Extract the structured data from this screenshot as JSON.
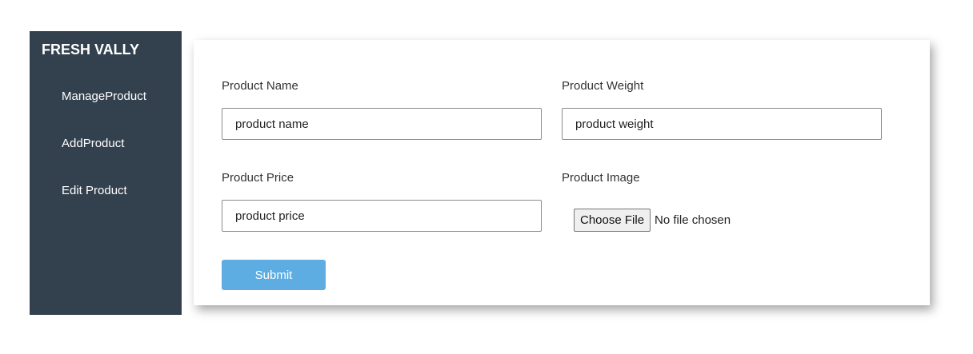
{
  "sidebar": {
    "brand": "FRESH VALLY",
    "items": [
      {
        "label": "ManageProduct"
      },
      {
        "label": "AddProduct"
      },
      {
        "label": "Edit Product"
      }
    ]
  },
  "form": {
    "name": {
      "label": "Product Name",
      "placeholder": "product name"
    },
    "weight": {
      "label": "Product Weight",
      "placeholder": "product weight"
    },
    "price": {
      "label": "Product Price",
      "placeholder": "product price"
    },
    "image": {
      "label": "Product Image",
      "button": "Choose File",
      "status": "No file chosen"
    },
    "submit_label": "Submit"
  },
  "colors": {
    "sidebar_bg": "#33414e",
    "accent": "#5dade2"
  }
}
